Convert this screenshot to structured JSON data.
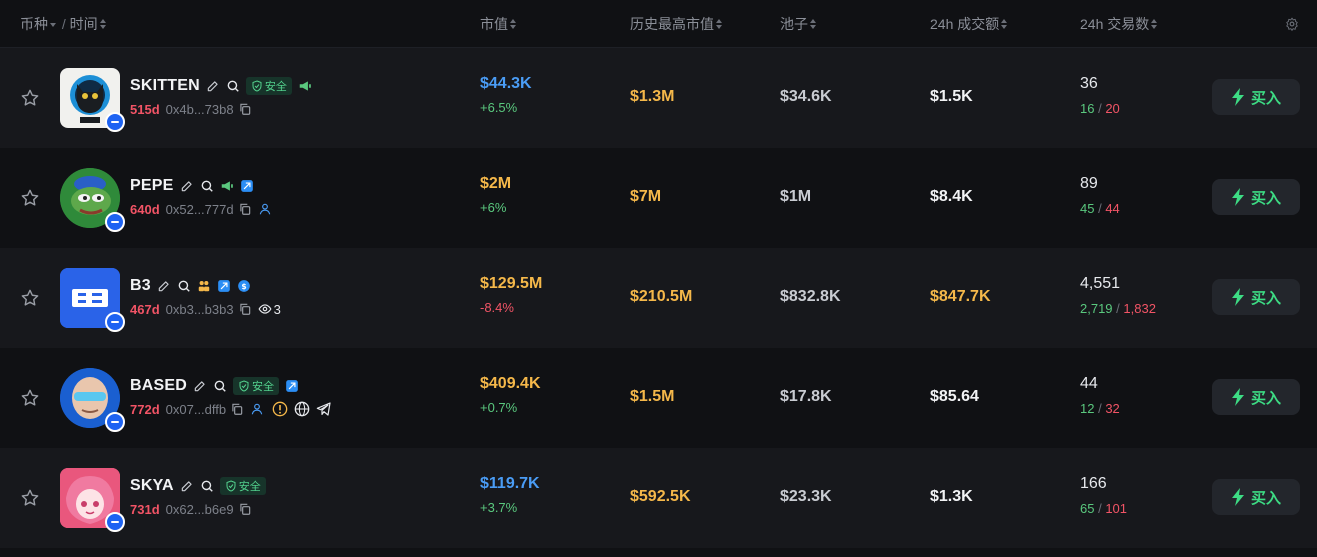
{
  "header": {
    "coin_label": "币种",
    "sep": "/",
    "time_label": "时间",
    "cols": [
      "市值",
      "历史最高市值",
      "池子",
      "24h 成交额",
      "24h 交易数"
    ]
  },
  "buy_label": "买入",
  "safe_label": "安全",
  "colors": {
    "positive": "#5ac87e",
    "negative": "#f25466",
    "accent_blue": "#4a9cf5",
    "accent_yellow": "#f5b84a",
    "buy_green": "#3ddc84"
  },
  "rows": [
    {
      "symbol": "SKITTEN",
      "age": "515d",
      "address": "0x4b...73b8",
      "market_cap": "$44.3K",
      "change": "+6.5%",
      "ath": "$1.3M",
      "pool": "$34.6K",
      "volume": "$1.5K",
      "txns": "36",
      "buys": "16",
      "sells": "20",
      "watchers": "",
      "icons": [
        "edit-icon",
        "search-icon",
        "shield-safe-badge",
        "megaphone-icon"
      ]
    },
    {
      "symbol": "PEPE",
      "age": "640d",
      "address": "0x52...777d",
      "market_cap": "$2M",
      "change": "+6%",
      "ath": "$7M",
      "pool": "$1M",
      "volume": "$8.4K",
      "txns": "89",
      "buys": "45",
      "sells": "44",
      "watchers": "",
      "icons": [
        "edit-icon",
        "search-icon",
        "megaphone-icon",
        "twitter-icon",
        "user-icon"
      ]
    },
    {
      "symbol": "B3",
      "age": "467d",
      "address": "0xb3...b3b3",
      "market_cap": "$129.5M",
      "change": "-8.4%",
      "ath": "$210.5M",
      "pool": "$832.8K",
      "volume": "$847.7K",
      "txns": "4,551",
      "buys": "2,719",
      "sells": "1,832",
      "watchers": "3",
      "icons": [
        "edit-icon",
        "search-icon",
        "holders-icon",
        "twitter-icon",
        "dollar-icon",
        "eye-icon"
      ]
    },
    {
      "symbol": "BASED",
      "age": "772d",
      "address": "0x07...dffb",
      "market_cap": "$409.4K",
      "change": "+0.7%",
      "ath": "$1.5M",
      "pool": "$17.8K",
      "volume": "$85.64",
      "txns": "44",
      "buys": "12",
      "sells": "32",
      "watchers": "",
      "icons": [
        "edit-icon",
        "search-icon",
        "shield-safe-badge",
        "twitter-icon",
        "user-icon",
        "warning-icon",
        "globe-icon",
        "telegram-icon"
      ]
    },
    {
      "symbol": "SKYA",
      "age": "731d",
      "address": "0x62...b6e9",
      "market_cap": "$119.7K",
      "change": "+3.7%",
      "ath": "$592.5K",
      "pool": "$23.3K",
      "volume": "$1.3K",
      "txns": "166",
      "buys": "65",
      "sells": "101",
      "watchers": "",
      "icons": [
        "edit-icon",
        "search-icon",
        "shield-safe-badge"
      ]
    }
  ]
}
